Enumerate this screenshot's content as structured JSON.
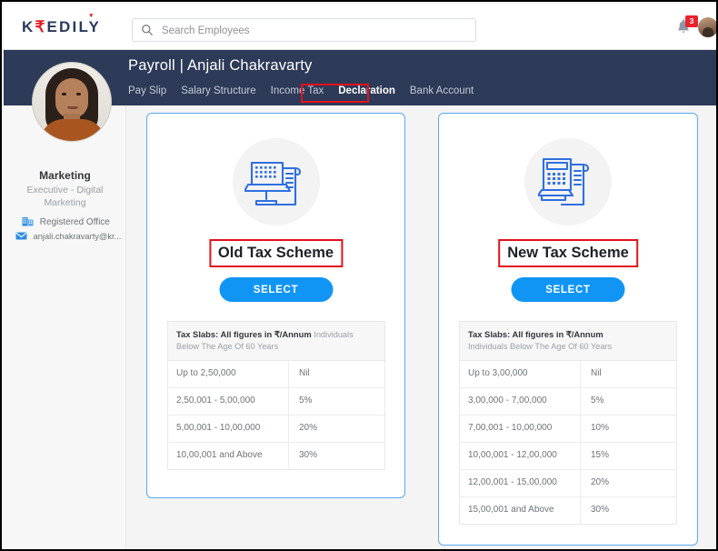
{
  "brand": {
    "logo_prefix": "K",
    "logo_rupee": "₹",
    "logo_mid": "EDIL",
    "logo_last": "Y",
    "accent_navy": "#2d3a58",
    "accent_blue": "#1195f5",
    "accent_red": "#e2111c",
    "card_border": "#5aa9f0"
  },
  "search": {
    "placeholder": "Search Employees",
    "value": ""
  },
  "notifications": {
    "count": "3"
  },
  "header": {
    "title": "Payroll | Anjali Chakravarty",
    "tabs": [
      {
        "label": "Pay Slip",
        "active": false
      },
      {
        "label": "Salary Structure",
        "active": false
      },
      {
        "label": "Income Tax",
        "active": false
      },
      {
        "label": "Declaration",
        "active": true
      },
      {
        "label": "Bank Account",
        "active": false
      }
    ]
  },
  "sidebar": {
    "department": "Marketing",
    "role": "Executive - Digital Marketing",
    "office": "Registered Office",
    "email": "anjali.chakravarty@kr..."
  },
  "cards": [
    {
      "icon": "laptop-document-icon",
      "title": "Old Tax Scheme",
      "select_label": "SELECT",
      "table": {
        "head_bold": "Tax Slabs: All figures in ₹/Annum",
        "head_light": "Individuals Below The Age Of 60 Years",
        "rows": [
          {
            "slab": "Up to 2,50,000",
            "rate": "Nil"
          },
          {
            "slab": "2,50,001 - 5,00,000",
            "rate": "5%"
          },
          {
            "slab": "5,00,001 - 10,00,000",
            "rate": "20%"
          },
          {
            "slab": "10,00,001 and Above",
            "rate": "30%"
          }
        ]
      }
    },
    {
      "icon": "calculator-document-icon",
      "title": "New Tax Scheme",
      "select_label": "SELECT",
      "table": {
        "head_bold": "Tax Slabs: All figures in ₹/Annum",
        "head_light": "Individuals Below The Age Of 60 Years",
        "rows": [
          {
            "slab": "Up to 3,00,000",
            "rate": "Nil"
          },
          {
            "slab": "3,00,000 - 7,00,000",
            "rate": "5%"
          },
          {
            "slab": "7,00,001 - 10,00,000",
            "rate": "10%"
          },
          {
            "slab": "10,00,001 - 12,00,000",
            "rate": "15%"
          },
          {
            "slab": "12,00,001 - 15,00,000",
            "rate": "20%"
          },
          {
            "slab": "15,00,001 and Above",
            "rate": "30%"
          }
        ]
      }
    }
  ]
}
